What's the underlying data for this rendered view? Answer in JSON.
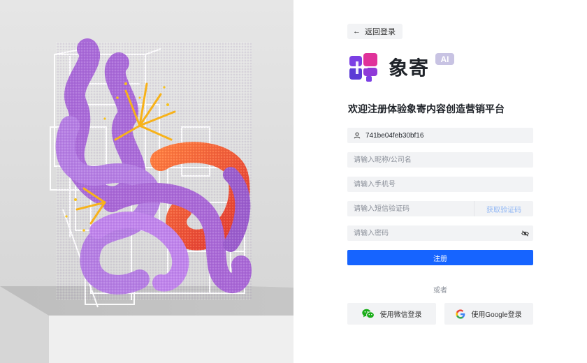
{
  "back": {
    "label": "返回登录"
  },
  "brand": {
    "name": "象寄",
    "badge": "AI"
  },
  "headline": "欢迎注册体验象寄内容创造营销平台",
  "form": {
    "username_value": "741be04feb30bf16",
    "nickname_placeholder": "请输入昵称/公司名",
    "phone_placeholder": "请输入手机号",
    "sms_placeholder": "请输入短信验证码",
    "get_code_label": "获取验证码",
    "password_placeholder": "请输入密码"
  },
  "register_label": "注册",
  "divider": "或者",
  "social": {
    "wechat_label": "使用微信登录",
    "google_label": "使用Google登录"
  },
  "colors": {
    "primary": "#1664ff",
    "logo_purple": "#7b3fe4",
    "logo_magenta": "#e0329a",
    "ai_badge": "#c8c3e3"
  }
}
